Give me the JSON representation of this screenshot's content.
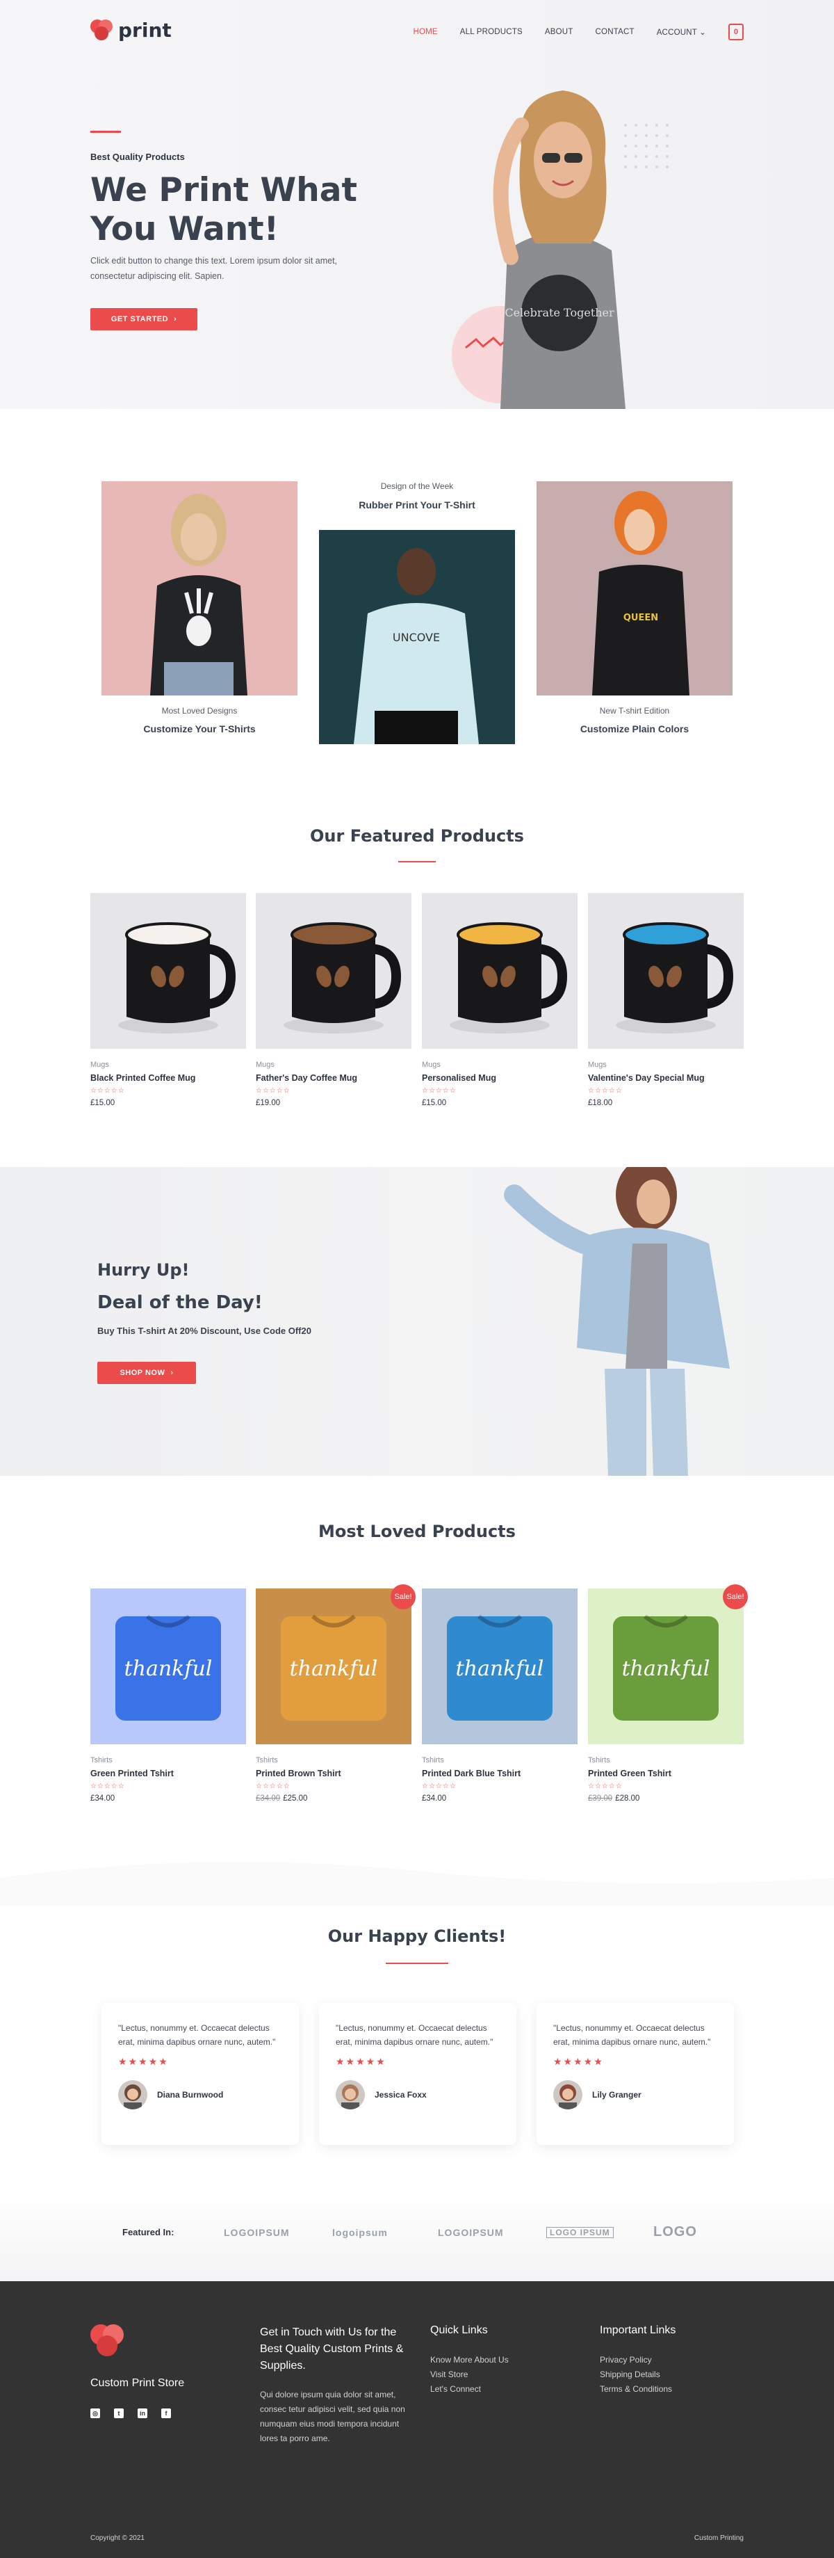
{
  "header": {
    "logo_text": "print",
    "nav": [
      "HOME",
      "ALL PRODUCTS",
      "ABOUT",
      "CONTACT",
      "ACCOUNT"
    ],
    "cart_count": "0"
  },
  "hero": {
    "subtitle": "Best Quality Products",
    "title": "We Print What You Want!",
    "text": "Click edit button to change this text. Lorem ipsum dolor sit amet, consectetur adipiscing elit. Sapien.",
    "button": "GET STARTED",
    "shirt_text": "Celebrate Together"
  },
  "designs": {
    "left": {
      "caption": "Most Loved Designs",
      "title": "Customize Your T-Shirts"
    },
    "center": {
      "caption": "Design of the Week",
      "title": "Rubber Print Your T-Shirt",
      "shirt_text": "UNCOVE"
    },
    "right": {
      "caption": "New T-shirt Edition",
      "title": "Customize Plain Colors",
      "shirt_text": "QUEEN"
    }
  },
  "featured": {
    "title": "Our Featured Products",
    "products": [
      {
        "category": "Mugs",
        "name": "Black Printed Coffee Mug",
        "price": "£15.00",
        "rim": "#f4f1ee"
      },
      {
        "category": "Mugs",
        "name": "Father's Day Coffee Mug",
        "price": "£19.00",
        "rim": "#8a5a38"
      },
      {
        "category": "Mugs",
        "name": "Personalised Mug",
        "price": "£15.00",
        "rim": "#f0b542"
      },
      {
        "category": "Mugs",
        "name": "Valentine's Day Special Mug",
        "price": "£18.00",
        "rim": "#2fa0d8"
      }
    ]
  },
  "deal": {
    "kicker": "Hurry Up!",
    "title": "Deal of the Day!",
    "text": "Buy This T-shirt At 20% Discount, Use Code Off20",
    "button": "SHOP NOW"
  },
  "loved": {
    "title": "Most Loved Products",
    "sale_label": "Sale!",
    "shirt_text": "thankful",
    "products": [
      {
        "category": "Tshirts",
        "name": "Green Printed Tshirt",
        "old_price": "",
        "price": "£34.00",
        "sale": false,
        "bg": "#b9c8fb",
        "shirt": "#3a73e8"
      },
      {
        "category": "Tshirts",
        "name": "Printed Brown Tshirt",
        "old_price": "£34.00",
        "price": "£25.00",
        "sale": true,
        "bg": "#c98f48",
        "shirt": "#e29d3c"
      },
      {
        "category": "Tshirts",
        "name": "Printed Dark Blue Tshirt",
        "old_price": "",
        "price": "£34.00",
        "sale": false,
        "bg": "#b3c6dc",
        "shirt": "#2f8ad0"
      },
      {
        "category": "Tshirts",
        "name": "Printed Green Tshirt",
        "old_price": "£39.00",
        "price": "£28.00",
        "sale": true,
        "bg": "#def0c6",
        "shirt": "#6a9e3c"
      }
    ]
  },
  "clients": {
    "title": "Our Happy Clients!",
    "items": [
      {
        "quote": "\"Lectus, nonummy et. Occaecat delectus erat, minima dapibus ornare nunc, autem.\"",
        "name": "Diana Burnwood"
      },
      {
        "quote": "\"Lectus, nonummy et. Occaecat delectus erat, minima dapibus ornare nunc, autem.\"",
        "name": "Jessica Foxx"
      },
      {
        "quote": "\"Lectus, nonummy et. Occaecat delectus erat, minima dapibus ornare nunc, autem.\"",
        "name": "Lily Granger"
      }
    ],
    "stars": "★★★★★"
  },
  "featured_in": {
    "label": "Featured In:",
    "logos": [
      "LOGOIPSUM",
      "logoipsum",
      "LOGOIPSUM",
      "LOGO IPSUM",
      "LOGO"
    ]
  },
  "footer": {
    "store_name": "Custom Print Store",
    "contact_title": "Get in Touch with Us for the Best Quality Custom Prints & Supplies.",
    "contact_text": "Qui dolore ipsum quia dolor sit amet, consec tetur adipisci velit, sed quia non numquam eius modi tempora incidunt lores ta porro ame.",
    "quick_title": "Quick Links",
    "quick_links": [
      "Know More About Us",
      "Visit Store",
      "Let's Connect"
    ],
    "important_title": "Important Links",
    "important_links": [
      "Privacy Policy",
      "Shipping Details",
      "Terms & Conditions"
    ],
    "copyright": "Copyright © 2021",
    "bottom_right": "Custom Printing"
  },
  "colors": {
    "accent": "#ec4b4b",
    "footer_bg": "#333334"
  }
}
